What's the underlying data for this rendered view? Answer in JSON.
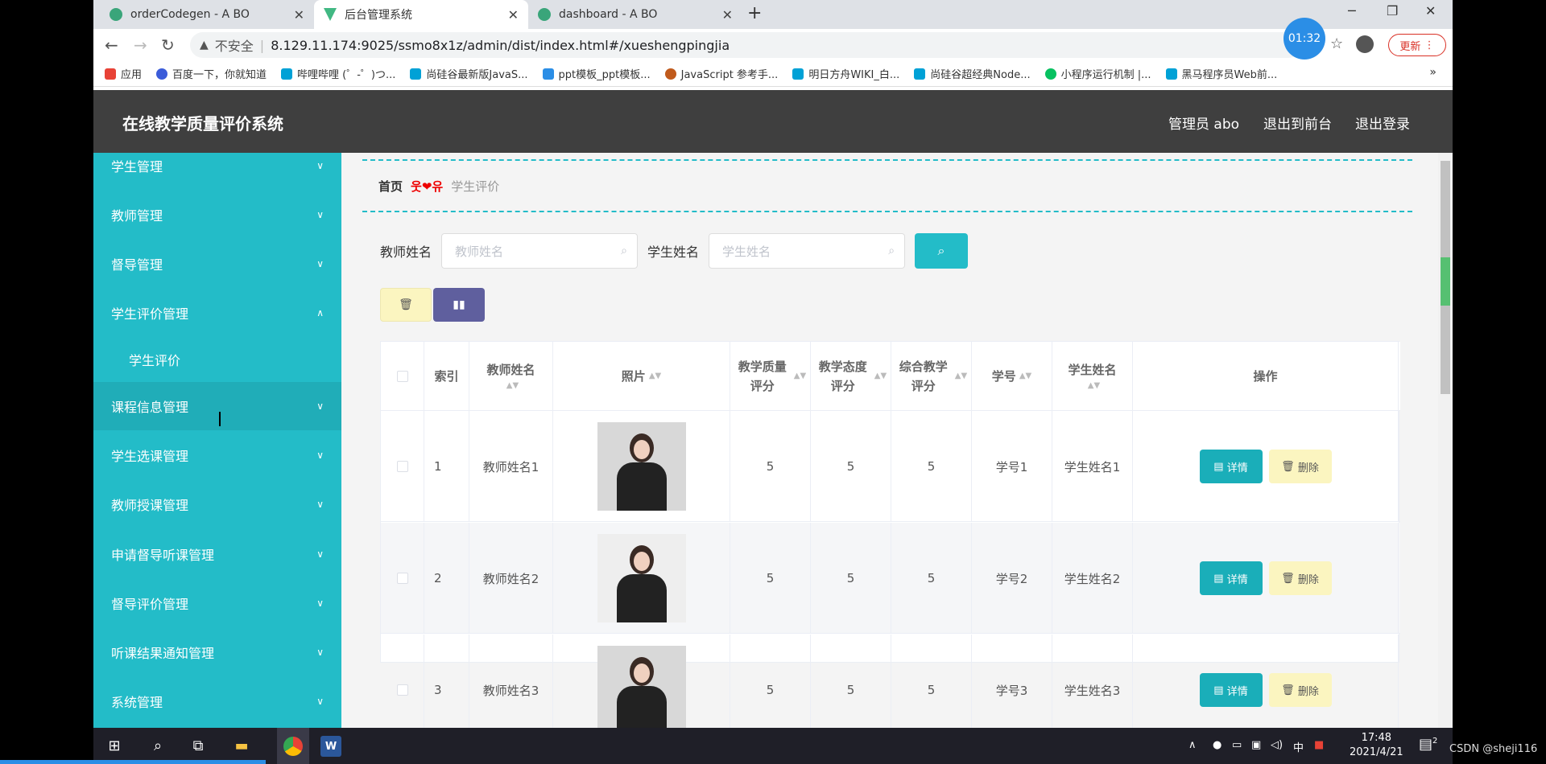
{
  "browser": {
    "tabs": [
      {
        "title": "orderCodegen - A BO",
        "favicon_color": "#3aa57a",
        "active": false
      },
      {
        "title": "后台管理系统",
        "favicon_color": "#41b883",
        "active": true
      },
      {
        "title": "dashboard - A BO",
        "favicon_color": "#3aa57a",
        "active": false
      }
    ],
    "new_tab": "+",
    "insecure_label": "不安全",
    "url": "8.129.11.174:9025/ssmo8x1z/admin/dist/index.html#/xueshengpingjia",
    "timer": "01:32",
    "update_label": "更新",
    "bookmarks": [
      {
        "label": "应用",
        "color": "#e84236"
      },
      {
        "label": "百度一下，你就知道",
        "color": "#3b5cd9"
      },
      {
        "label": "哔哩哔哩 (゜-゜)つ...",
        "color": "#00a1d6"
      },
      {
        "label": "尚硅谷最新版JavaS...",
        "color": "#00a1d6"
      },
      {
        "label": "ppt模板_ppt模板...",
        "color": "#2b8ee6"
      },
      {
        "label": "JavaScript 参考手...",
        "color": "#c05a1c"
      },
      {
        "label": "明日方舟WIKI_白...",
        "color": "#00a1d6"
      },
      {
        "label": "尚硅谷超经典Node...",
        "color": "#00a1d6"
      },
      {
        "label": "小程序运行机制 |...",
        "color": "#07c160"
      },
      {
        "label": "黑马程序员Web前...",
        "color": "#00a1d6"
      }
    ],
    "bookmarks_more": "»"
  },
  "app": {
    "title": "在线教学质量评价系统",
    "header_links": [
      "管理员 abo",
      "退出到前台",
      "退出登录"
    ],
    "sidebar": {
      "items": [
        {
          "label": "学生管理",
          "expanded": false
        },
        {
          "label": "教师管理",
          "expanded": false
        },
        {
          "label": "督导管理",
          "expanded": false
        },
        {
          "label": "学生评价管理",
          "expanded": true
        },
        {
          "label": "课程信息管理",
          "expanded": false
        },
        {
          "label": "学生选课管理",
          "expanded": false
        },
        {
          "label": "教师授课管理",
          "expanded": false
        },
        {
          "label": "申请督导听课管理",
          "expanded": false
        },
        {
          "label": "督导评价管理",
          "expanded": false
        },
        {
          "label": "听课结果通知管理",
          "expanded": false
        },
        {
          "label": "系统管理",
          "expanded": false
        }
      ],
      "submenu": "学生评价"
    },
    "breadcrumb": {
      "home": "首页",
      "separator": "웃❤유",
      "current": "学生评价"
    },
    "search": {
      "teacher_label": "教师姓名",
      "teacher_placeholder": "教师姓名",
      "student_label": "学生姓名",
      "student_placeholder": "学生姓名"
    },
    "table": {
      "columns": [
        "索引",
        "教师姓名",
        "照片",
        "教学质量评分",
        "教学态度评分",
        "综合教学评分",
        "学号",
        "学生姓名",
        "操作"
      ],
      "rows": [
        {
          "index": "1",
          "teacher": "教师姓名1",
          "quality": "5",
          "attitude": "5",
          "overall": "5",
          "student_id": "学号1",
          "student": "学生姓名1"
        },
        {
          "index": "2",
          "teacher": "教师姓名2",
          "quality": "5",
          "attitude": "5",
          "overall": "5",
          "student_id": "学号2",
          "student": "学生姓名2"
        },
        {
          "index": "3",
          "teacher": "教师姓名3",
          "quality": "5",
          "attitude": "5",
          "overall": "5",
          "student_id": "学号3",
          "student": "学生姓名3"
        }
      ],
      "detail_label": "详情",
      "delete_label": "删除"
    }
  },
  "taskbar": {
    "time": "17:48",
    "date": "2021/4/21",
    "ime": "中",
    "notifications": "2"
  },
  "watermark": "CSDN @sheji116"
}
